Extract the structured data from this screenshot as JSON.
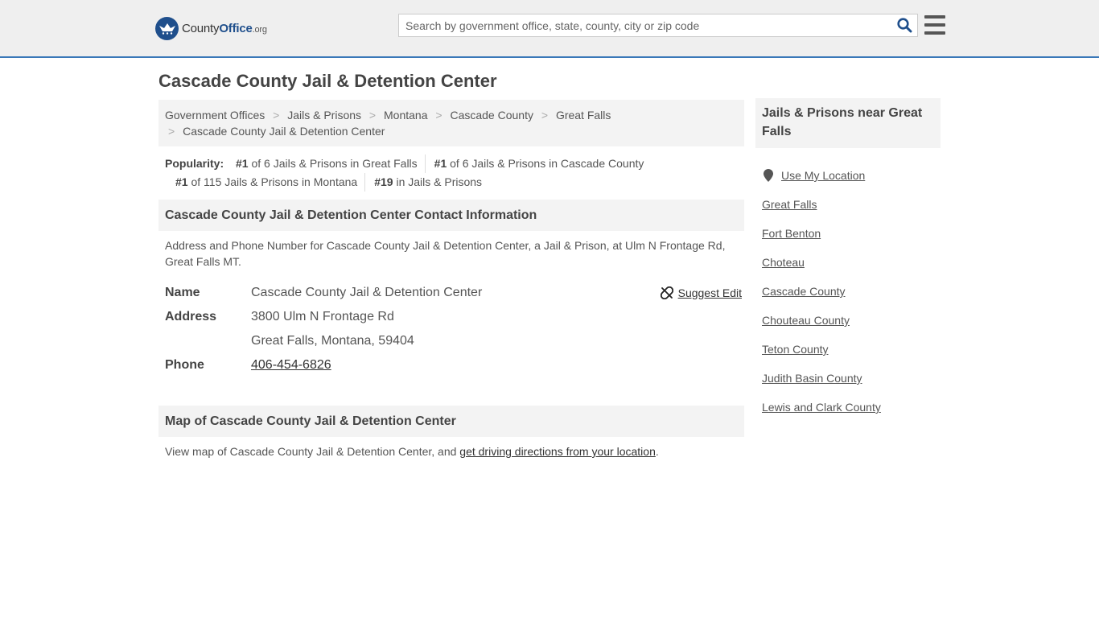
{
  "header": {
    "logo": {
      "part1": "County",
      "part2": "Office",
      "part3": ".org"
    },
    "search_placeholder": "Search by government office, state, county, city or zip code"
  },
  "page_title": "Cascade County Jail & Detention Center",
  "breadcrumb": {
    "items": [
      "Government Offices",
      "Jails & Prisons",
      "Montana",
      "Cascade County",
      "Great Falls"
    ],
    "current": "Cascade County Jail & Detention Center",
    "separator": ">"
  },
  "popularity": {
    "label": "Popularity:",
    "items": [
      {
        "rank": "#1",
        "text": " of 6 Jails & Prisons in Great Falls"
      },
      {
        "rank": "#1",
        "text": " of 6 Jails & Prisons in Cascade County"
      },
      {
        "rank": "#1",
        "text": " of 115 Jails & Prisons in Montana"
      },
      {
        "rank": "#19",
        "text": " in Jails & Prisons"
      }
    ]
  },
  "contact": {
    "heading": "Cascade County Jail & Detention Center Contact Information",
    "description": "Address and Phone Number for Cascade County Jail & Detention Center, a Jail & Prison, at Ulm N Frontage Rd, Great Falls MT.",
    "name_label": "Name",
    "name": "Cascade County Jail & Detention Center",
    "address_label": "Address",
    "address_line1": "3800 Ulm N Frontage Rd",
    "address_line2": "Great Falls, Montana, 59404",
    "phone_label": "Phone",
    "phone": "406-454-6826",
    "suggest_edit": "Suggest Edit"
  },
  "map": {
    "heading": "Map of Cascade County Jail & Detention Center",
    "text": "View map of Cascade County Jail & Detention Center, and ",
    "link": "get driving directions from your location",
    "tail": "."
  },
  "sidebar": {
    "heading": "Jails & Prisons near Great Falls",
    "use_location": "Use My Location",
    "links": [
      "Great Falls",
      "Fort Benton",
      "Choteau",
      "Cascade County",
      "Chouteau County",
      "Teton County",
      "Judith Basin County",
      "Lewis and Clark County"
    ]
  },
  "colors": {
    "brand": "#1f4f8c",
    "accent_border": "#3a78b8",
    "panel": "#f3f3f3"
  },
  "icons": [
    "logo-badge-icon",
    "search-icon",
    "hamburger-menu-icon",
    "unlink-icon",
    "map-pin-icon"
  ]
}
